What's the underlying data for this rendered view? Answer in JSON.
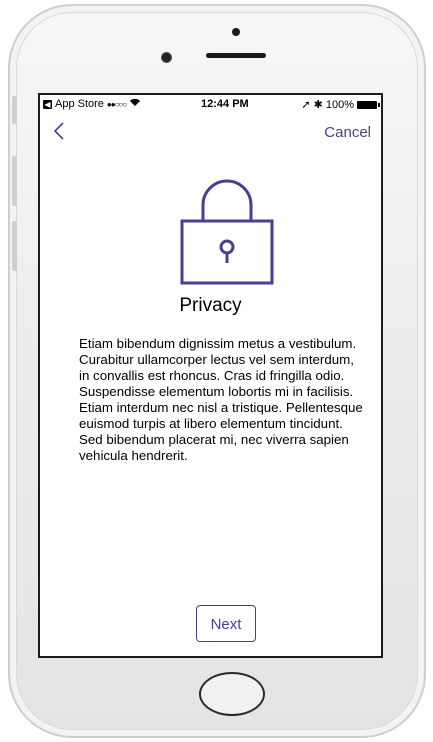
{
  "status_bar": {
    "back_app": "App Store",
    "signal": "●●○○○",
    "time": "12:44 PM",
    "battery": "100%"
  },
  "nav": {
    "back_icon": "chevron-left-icon",
    "cancel_label": "Cancel"
  },
  "content": {
    "icon": "lock-icon",
    "title": "Privacy",
    "body": "Etiam bibendum dignissim metus a vestibulum. Curabitur ullamcorper lectus vel sem interdum, in convallis est rhoncus. Cras id fringilla odio. Suspendisse elementum lobortis mi in facilisis. Etiam interdum nec nisl a tristique. Pellentesque euismod turpis at libero elementum tincidunt. Sed bibendum placerat mi, nec viverra sapien vehicula hendrerit."
  },
  "footer": {
    "next_label": "Next"
  },
  "colors": {
    "accent": "#4b3d91"
  }
}
